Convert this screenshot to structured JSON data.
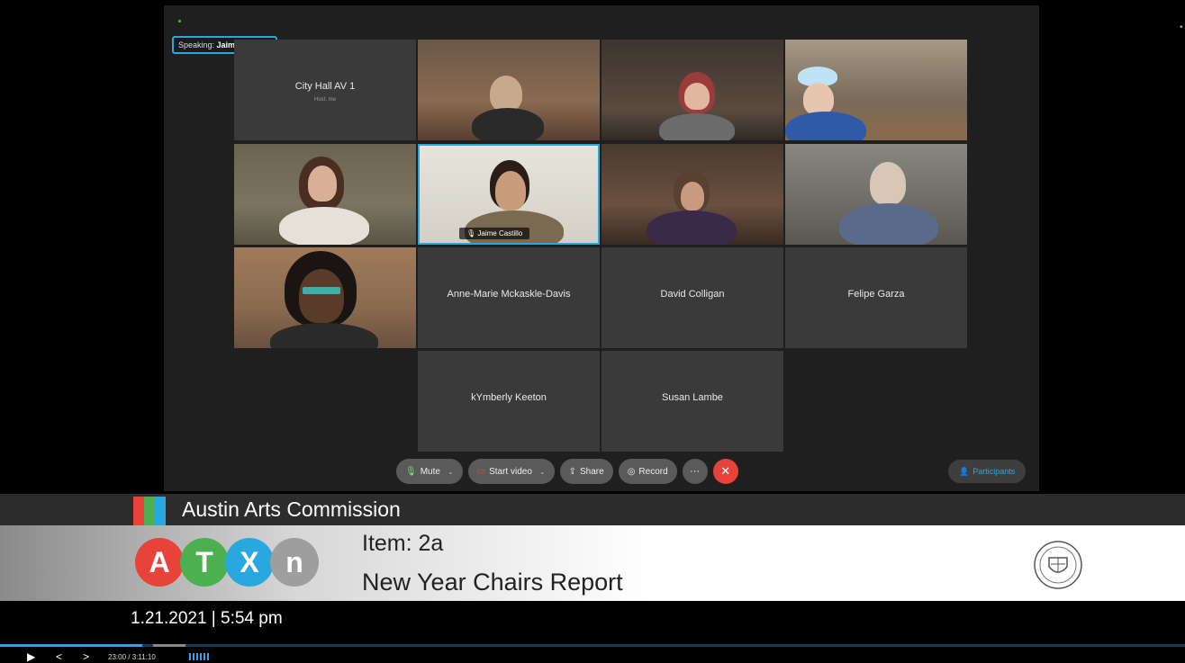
{
  "meeting": {
    "speaking_prefix": "Speaking:",
    "speaking_name": "Jaime Castillo",
    "tiles": {
      "city_hall": {
        "name": "City Hall AV 1",
        "sub": "Host, me"
      },
      "active_speaker": "Jaime Castillo",
      "anne_marie": "Anne-Marie Mckaskle-Davis",
      "david": "David Colligan",
      "felipe": "Felipe Garza",
      "kymberly": "kYmberly Keeton",
      "susan": "Susan Lambe"
    },
    "toolbar": {
      "mute": "Mute",
      "start_video": "Start video",
      "share": "Share",
      "record": "Record",
      "more": "···",
      "end": "✕",
      "participants": "Participants"
    }
  },
  "broadcast": {
    "org": "Austin Arts Commission",
    "logo_letters": [
      "A",
      "T",
      "X",
      "n"
    ],
    "logo_colors": [
      "#e8433a",
      "#4caf50",
      "#29a8e0",
      "#9e9e9e"
    ],
    "bar_colors": [
      "#e8433a",
      "#4caf50",
      "#29a8e0"
    ],
    "item": "Item: 2a",
    "title": "New Year Chairs Report",
    "datetime": "1.21.2021 | 5:54 pm"
  },
  "player": {
    "timecode": "23:00 / 3:11:10",
    "progress_fraction": 0.12
  }
}
